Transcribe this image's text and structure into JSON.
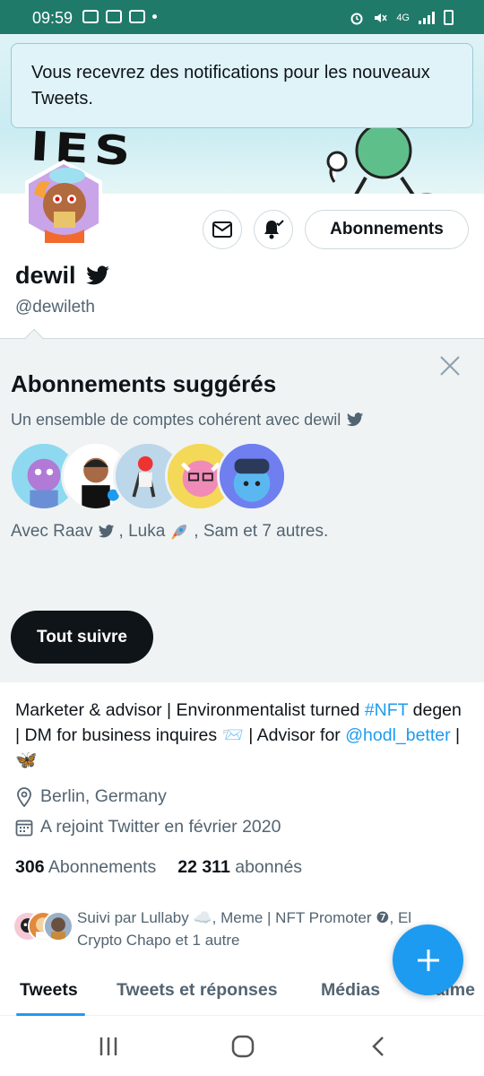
{
  "status_bar": {
    "time": "09:59",
    "network": "4G"
  },
  "toast": {
    "message": "Vous recevrez des notifications pour les nouveaux Tweets."
  },
  "banner": {
    "text": "IES"
  },
  "profile": {
    "name": "dewil",
    "handle": "@dewileth",
    "follow_button": "Abonnements"
  },
  "suggestions": {
    "title": "Abonnements suggérés",
    "subtitle": "Un ensemble de comptes cohérent avec dewil",
    "with_prefix": "Avec Raav",
    "with_middle": ", Luka",
    "with_suffix": ", Sam et 7 autres.",
    "follow_all": "Tout suivre"
  },
  "bio": {
    "line_part1": "Marketer & advisor | Environmentalist turned ",
    "hashtag": "#NFT",
    "line_part2": " degen | DM for business inquires ",
    "envelope": "📨",
    "line_part3": " | Advisor for ",
    "mention": "@hodl_better",
    "line_part4": " | ",
    "butterfly": "🦋",
    "location": "Berlin, Germany",
    "joined": "A rejoint Twitter en février 2020"
  },
  "counts": {
    "following_value": "306",
    "following_label": "Abonnements",
    "followers_value": "22 311",
    "followers_label": "abonnés"
  },
  "followed_by": {
    "text": "Suivi par Lullaby ☁️, Meme | NFT Promoter ❼, El Crypto Chapo et 1 autre"
  },
  "tabs": [
    {
      "label": "Tweets"
    },
    {
      "label": "Tweets et réponses"
    },
    {
      "label": "Médias"
    },
    {
      "label": "J'aime"
    }
  ],
  "colors": {
    "status_bar": "#1f7a6a",
    "accent": "#1d9bf0",
    "panel": "#eff3f4",
    "text": "#0f1419",
    "secondary_text": "#536471"
  }
}
